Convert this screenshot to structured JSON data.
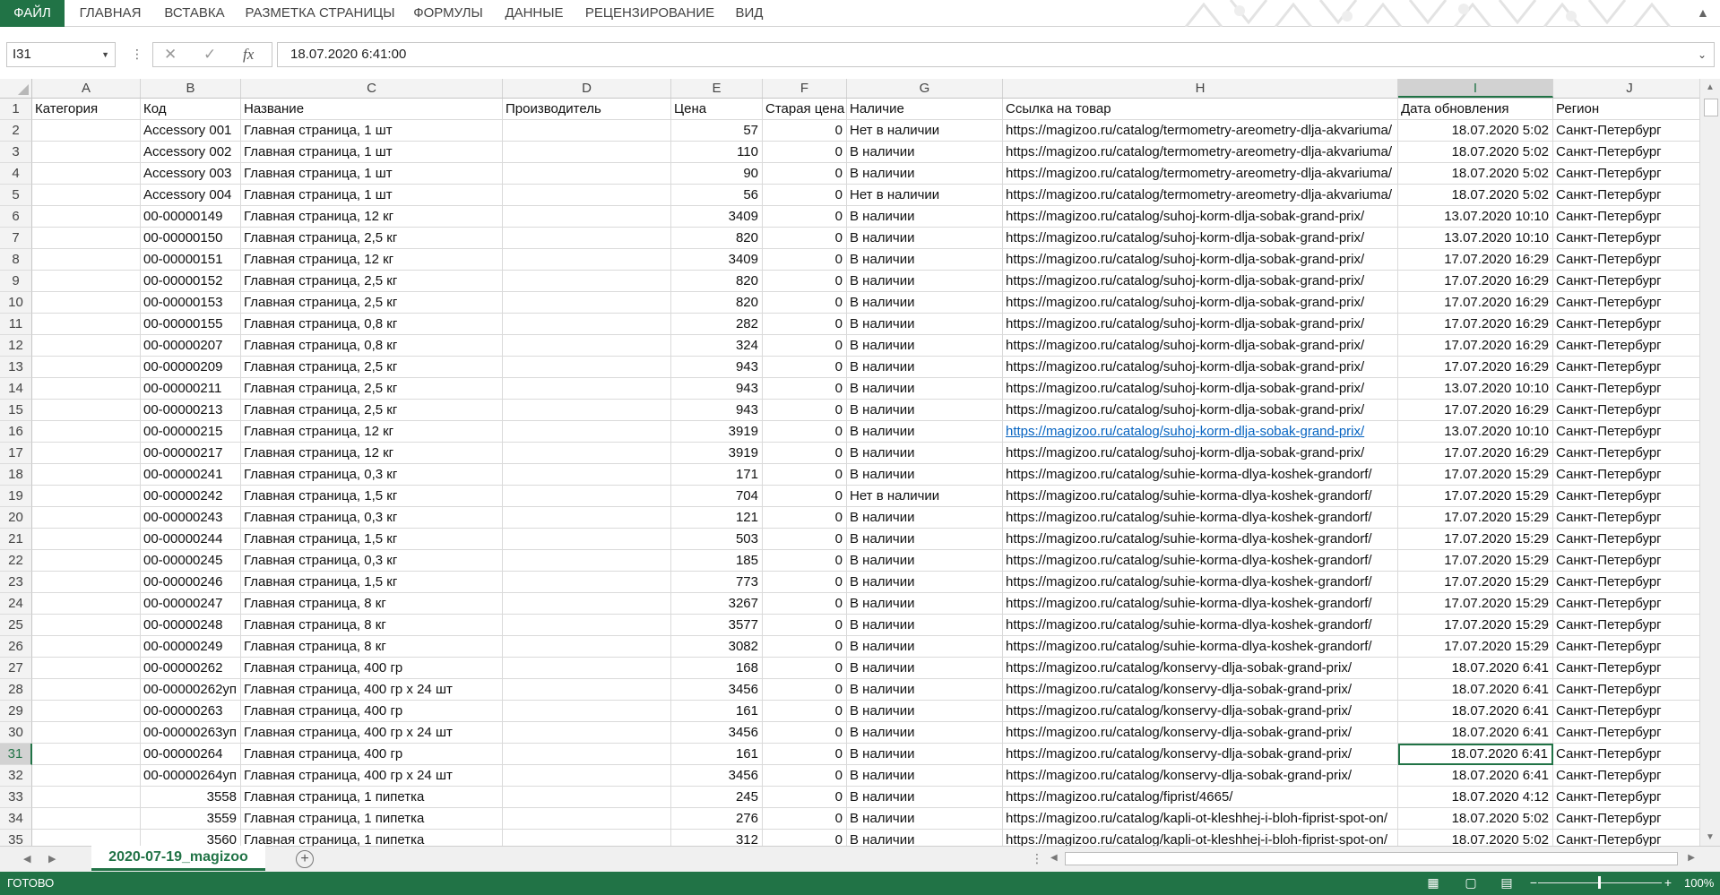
{
  "ribbon": {
    "tabs": [
      "ФАЙЛ",
      "ГЛАВНАЯ",
      "ВСТАВКА",
      "РАЗМЕТКА СТРАНИЦЫ",
      "ФОРМУЛЫ",
      "ДАННЫЕ",
      "РЕЦЕНЗИРОВАНИЕ",
      "ВИД"
    ],
    "active_color": "#217346"
  },
  "formula_bar": {
    "name_box": "I31",
    "cancel_icon": "close-icon",
    "enter_icon": "check-icon",
    "fx_label": "fx",
    "value": "18.07.2020  6:41:00"
  },
  "grid": {
    "columns": [
      "A",
      "B",
      "C",
      "D",
      "E",
      "F",
      "G",
      "H",
      "I",
      "J"
    ],
    "selected_column": "I",
    "selected_row": "31",
    "header_row": [
      "Категория",
      "Код",
      "Название",
      "Производитель",
      "Цена",
      "Старая цена",
      "Наличие",
      "Ссылка на товар",
      "Дата обновления",
      "Регион"
    ],
    "rows": [
      {
        "n": "2",
        "b": "Accessory 001",
        "c": "Главная страница, 1 шт",
        "e": "57",
        "f": "0",
        "g": "Нет в наличии",
        "h": "https://magizoo.ru/catalog/termometry-areometry-dlja-akvariuma/",
        "i": "18.07.2020 5:02",
        "j": "Санкт-Петербург"
      },
      {
        "n": "3",
        "b": "Accessory 002",
        "c": "Главная страница, 1 шт",
        "e": "110",
        "f": "0",
        "g": "В наличии",
        "h": "https://magizoo.ru/catalog/termometry-areometry-dlja-akvariuma/",
        "i": "18.07.2020 5:02",
        "j": "Санкт-Петербург"
      },
      {
        "n": "4",
        "b": "Accessory 003",
        "c": "Главная страница, 1 шт",
        "e": "90",
        "f": "0",
        "g": "В наличии",
        "h": "https://magizoo.ru/catalog/termometry-areometry-dlja-akvariuma/",
        "i": "18.07.2020 5:02",
        "j": "Санкт-Петербург"
      },
      {
        "n": "5",
        "b": "Accessory 004",
        "c": "Главная страница, 1 шт",
        "e": "56",
        "f": "0",
        "g": "Нет в наличии",
        "h": "https://magizoo.ru/catalog/termometry-areometry-dlja-akvariuma/",
        "i": "18.07.2020 5:02",
        "j": "Санкт-Петербург"
      },
      {
        "n": "6",
        "b": "00-00000149",
        "c": "Главная страница, 12 кг",
        "e": "3409",
        "f": "0",
        "g": "В наличии",
        "h": "https://magizoo.ru/catalog/suhoj-korm-dlja-sobak-grand-prix/",
        "i": "13.07.2020 10:10",
        "j": "Санкт-Петербург"
      },
      {
        "n": "7",
        "b": "00-00000150",
        "c": "Главная страница, 2,5 кг",
        "e": "820",
        "f": "0",
        "g": "В наличии",
        "h": "https://magizoo.ru/catalog/suhoj-korm-dlja-sobak-grand-prix/",
        "i": "13.07.2020 10:10",
        "j": "Санкт-Петербург"
      },
      {
        "n": "8",
        "b": "00-00000151",
        "c": "Главная страница, 12 кг",
        "e": "3409",
        "f": "0",
        "g": "В наличии",
        "h": "https://magizoo.ru/catalog/suhoj-korm-dlja-sobak-grand-prix/",
        "i": "17.07.2020 16:29",
        "j": "Санкт-Петербург"
      },
      {
        "n": "9",
        "b": "00-00000152",
        "c": "Главная страница, 2,5 кг",
        "e": "820",
        "f": "0",
        "g": "В наличии",
        "h": "https://magizoo.ru/catalog/suhoj-korm-dlja-sobak-grand-prix/",
        "i": "17.07.2020 16:29",
        "j": "Санкт-Петербург"
      },
      {
        "n": "10",
        "b": "00-00000153",
        "c": "Главная страница, 2,5 кг",
        "e": "820",
        "f": "0",
        "g": "В наличии",
        "h": "https://magizoo.ru/catalog/suhoj-korm-dlja-sobak-grand-prix/",
        "i": "17.07.2020 16:29",
        "j": "Санкт-Петербург"
      },
      {
        "n": "11",
        "b": "00-00000155",
        "c": "Главная страница, 0,8 кг",
        "e": "282",
        "f": "0",
        "g": "В наличии",
        "h": "https://magizoo.ru/catalog/suhoj-korm-dlja-sobak-grand-prix/",
        "i": "17.07.2020 16:29",
        "j": "Санкт-Петербург"
      },
      {
        "n": "12",
        "b": "00-00000207",
        "c": "Главная страница, 0,8 кг",
        "e": "324",
        "f": "0",
        "g": "В наличии",
        "h": "https://magizoo.ru/catalog/suhoj-korm-dlja-sobak-grand-prix/",
        "i": "17.07.2020 16:29",
        "j": "Санкт-Петербург"
      },
      {
        "n": "13",
        "b": "00-00000209",
        "c": "Главная страница, 2,5 кг",
        "e": "943",
        "f": "0",
        "g": "В наличии",
        "h": "https://magizoo.ru/catalog/suhoj-korm-dlja-sobak-grand-prix/",
        "i": "17.07.2020 16:29",
        "j": "Санкт-Петербург"
      },
      {
        "n": "14",
        "b": "00-00000211",
        "c": "Главная страница, 2,5 кг",
        "e": "943",
        "f": "0",
        "g": "В наличии",
        "h": "https://magizoo.ru/catalog/suhoj-korm-dlja-sobak-grand-prix/",
        "i": "13.07.2020 10:10",
        "j": "Санкт-Петербург"
      },
      {
        "n": "15",
        "b": "00-00000213",
        "c": "Главная страница, 2,5 кг",
        "e": "943",
        "f": "0",
        "g": "В наличии",
        "h": "https://magizoo.ru/catalog/suhoj-korm-dlja-sobak-grand-prix/",
        "i": "17.07.2020 16:29",
        "j": "Санкт-Петербург"
      },
      {
        "n": "16",
        "b": "00-00000215",
        "c": "Главная страница, 12 кг",
        "e": "3919",
        "f": "0",
        "g": "В наличии",
        "h": "https://magizoo.ru/catalog/suhoj-korm-dlja-sobak-grand-prix/",
        "i": "13.07.2020 10:10",
        "j": "Санкт-Петербург",
        "link": true
      },
      {
        "n": "17",
        "b": "00-00000217",
        "c": "Главная страница, 12 кг",
        "e": "3919",
        "f": "0",
        "g": "В наличии",
        "h": "https://magizoo.ru/catalog/suhoj-korm-dlja-sobak-grand-prix/",
        "i": "17.07.2020 16:29",
        "j": "Санкт-Петербург"
      },
      {
        "n": "18",
        "b": "00-00000241",
        "c": "Главная страница, 0,3 кг",
        "e": "171",
        "f": "0",
        "g": "В наличии",
        "h": "https://magizoo.ru/catalog/suhie-korma-dlya-koshek-grandorf/",
        "i": "17.07.2020 15:29",
        "j": "Санкт-Петербург"
      },
      {
        "n": "19",
        "b": "00-00000242",
        "c": "Главная страница, 1,5 кг",
        "e": "704",
        "f": "0",
        "g": "Нет в наличии",
        "h": "https://magizoo.ru/catalog/suhie-korma-dlya-koshek-grandorf/",
        "i": "17.07.2020 15:29",
        "j": "Санкт-Петербург"
      },
      {
        "n": "20",
        "b": "00-00000243",
        "c": "Главная страница, 0,3 кг",
        "e": "121",
        "f": "0",
        "g": "В наличии",
        "h": "https://magizoo.ru/catalog/suhie-korma-dlya-koshek-grandorf/",
        "i": "17.07.2020 15:29",
        "j": "Санкт-Петербург"
      },
      {
        "n": "21",
        "b": "00-00000244",
        "c": "Главная страница, 1,5 кг",
        "e": "503",
        "f": "0",
        "g": "В наличии",
        "h": "https://magizoo.ru/catalog/suhie-korma-dlya-koshek-grandorf/",
        "i": "17.07.2020 15:29",
        "j": "Санкт-Петербург"
      },
      {
        "n": "22",
        "b": "00-00000245",
        "c": "Главная страница, 0,3 кг",
        "e": "185",
        "f": "0",
        "g": "В наличии",
        "h": "https://magizoo.ru/catalog/suhie-korma-dlya-koshek-grandorf/",
        "i": "17.07.2020 15:29",
        "j": "Санкт-Петербург"
      },
      {
        "n": "23",
        "b": "00-00000246",
        "c": "Главная страница, 1,5 кг",
        "e": "773",
        "f": "0",
        "g": "В наличии",
        "h": "https://magizoo.ru/catalog/suhie-korma-dlya-koshek-grandorf/",
        "i": "17.07.2020 15:29",
        "j": "Санкт-Петербург"
      },
      {
        "n": "24",
        "b": "00-00000247",
        "c": "Главная страница, 8 кг",
        "e": "3267",
        "f": "0",
        "g": "В наличии",
        "h": "https://magizoo.ru/catalog/suhie-korma-dlya-koshek-grandorf/",
        "i": "17.07.2020 15:29",
        "j": "Санкт-Петербург"
      },
      {
        "n": "25",
        "b": "00-00000248",
        "c": "Главная страница, 8 кг",
        "e": "3577",
        "f": "0",
        "g": "В наличии",
        "h": "https://magizoo.ru/catalog/suhie-korma-dlya-koshek-grandorf/",
        "i": "17.07.2020 15:29",
        "j": "Санкт-Петербург"
      },
      {
        "n": "26",
        "b": "00-00000249",
        "c": "Главная страница, 8 кг",
        "e": "3082",
        "f": "0",
        "g": "В наличии",
        "h": "https://magizoo.ru/catalog/suhie-korma-dlya-koshek-grandorf/",
        "i": "17.07.2020 15:29",
        "j": "Санкт-Петербург"
      },
      {
        "n": "27",
        "b": "00-00000262",
        "c": "Главная страница, 400 гр",
        "e": "168",
        "f": "0",
        "g": "В наличии",
        "h": "https://magizoo.ru/catalog/konservy-dlja-sobak-grand-prix/",
        "i": "18.07.2020 6:41",
        "j": "Санкт-Петербург"
      },
      {
        "n": "28",
        "b": "00-00000262уп",
        "c": "Главная страница, 400 гр x 24 шт",
        "e": "3456",
        "f": "0",
        "g": "В наличии",
        "h": "https://magizoo.ru/catalog/konservy-dlja-sobak-grand-prix/",
        "i": "18.07.2020 6:41",
        "j": "Санкт-Петербург"
      },
      {
        "n": "29",
        "b": "00-00000263",
        "c": "Главная страница, 400 гр",
        "e": "161",
        "f": "0",
        "g": "В наличии",
        "h": "https://magizoo.ru/catalog/konservy-dlja-sobak-grand-prix/",
        "i": "18.07.2020 6:41",
        "j": "Санкт-Петербург"
      },
      {
        "n": "30",
        "b": "00-00000263уп",
        "c": "Главная страница, 400 гр x 24 шт",
        "e": "3456",
        "f": "0",
        "g": "В наличии",
        "h": "https://magizoo.ru/catalog/konservy-dlja-sobak-grand-prix/",
        "i": "18.07.2020 6:41",
        "j": "Санкт-Петербург"
      },
      {
        "n": "31",
        "b": "00-00000264",
        "c": "Главная страница, 400 гр",
        "e": "161",
        "f": "0",
        "g": "В наличии",
        "h": "https://magizoo.ru/catalog/konservy-dlja-sobak-grand-prix/",
        "i": "18.07.2020 6:41",
        "j": "Санкт-Петербург",
        "active": true
      },
      {
        "n": "32",
        "b": "00-00000264уп",
        "c": "Главная страница, 400 гр x 24 шт",
        "e": "3456",
        "f": "0",
        "g": "В наличии",
        "h": "https://magizoo.ru/catalog/konservy-dlja-sobak-grand-prix/",
        "i": "18.07.2020 6:41",
        "j": "Санкт-Петербург"
      },
      {
        "n": "33",
        "b": "3558",
        "c": "Главная страница, 1 пипетка",
        "e": "245",
        "f": "0",
        "g": "В наличии",
        "h": "https://magizoo.ru/catalog/fiprist/4665/",
        "i": "18.07.2020 4:12",
        "j": "Санкт-Петербург",
        "bnum": true
      },
      {
        "n": "34",
        "b": "3559",
        "c": "Главная страница, 1 пипетка",
        "e": "276",
        "f": "0",
        "g": "В наличии",
        "h": "https://magizoo.ru/catalog/kapli-ot-kleshhej-i-bloh-fiprist-spot-on/",
        "i": "18.07.2020 5:02",
        "j": "Санкт-Петербург",
        "bnum": true
      },
      {
        "n": "35",
        "b": "3560",
        "c": "Главная страница, 1 пипетка",
        "e": "312",
        "f": "0",
        "g": "В наличии",
        "h": "https://magizoo.ru/catalog/kapli-ot-kleshhej-i-bloh-fiprist-spot-on/",
        "i": "18.07.2020 5:02",
        "j": "Санкт-Петербург",
        "bnum": true
      }
    ]
  },
  "sheet_tabs": {
    "active": "2020-07-19_magizoo",
    "add_icon": "plus-circle-icon"
  },
  "status_bar": {
    "text": "ГОТОВО",
    "zoom": "100%",
    "zoom_level": 1.0
  }
}
